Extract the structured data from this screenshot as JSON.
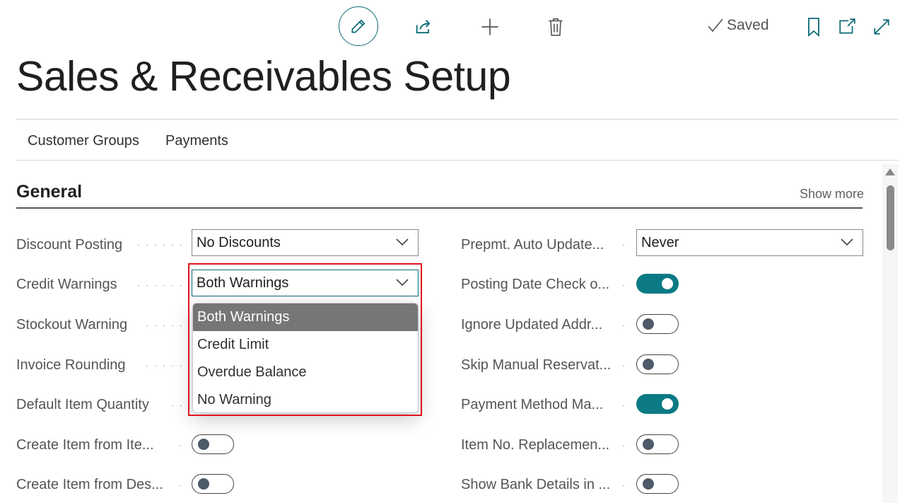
{
  "toolbar": {
    "saved_label": "Saved"
  },
  "page": {
    "title": "Sales & Receivables Setup"
  },
  "nav": {
    "items": [
      {
        "label": "Customer Groups"
      },
      {
        "label": "Payments"
      }
    ]
  },
  "section": {
    "title": "General",
    "show_more": "Show more"
  },
  "left_fields": [
    {
      "label": "Discount Posting",
      "value": "No Discounts"
    },
    {
      "label": "Credit Warnings",
      "value": "Both Warnings"
    },
    {
      "label": "Stockout Warning"
    },
    {
      "label": "Invoice Rounding"
    },
    {
      "label": "Default Item Quantity"
    },
    {
      "label": "Create Item from Ite...",
      "toggle": "off"
    },
    {
      "label": "Create Item from Des...",
      "toggle": "off"
    }
  ],
  "right_fields": [
    {
      "label": "Prepmt. Auto Update...",
      "value": "Never"
    },
    {
      "label": "Posting Date Check o...",
      "toggle": "on"
    },
    {
      "label": "Ignore Updated Addr...",
      "toggle": "off"
    },
    {
      "label": "Skip Manual Reservat...",
      "toggle": "off"
    },
    {
      "label": "Payment Method Ma...",
      "toggle": "on"
    },
    {
      "label": "Item No. Replacemen...",
      "toggle": "off"
    },
    {
      "label": "Show Bank Details in ...",
      "toggle": "off"
    }
  ],
  "dropdown": {
    "options": [
      "Both Warnings",
      "Credit Limit",
      "Overdue Balance",
      "No Warning"
    ],
    "selected": "Both Warnings"
  },
  "colors": {
    "accent": "#0b6a73",
    "toggle_on": "#0b7a84",
    "highlight": "#e0141e",
    "selected_option": "#767676"
  }
}
